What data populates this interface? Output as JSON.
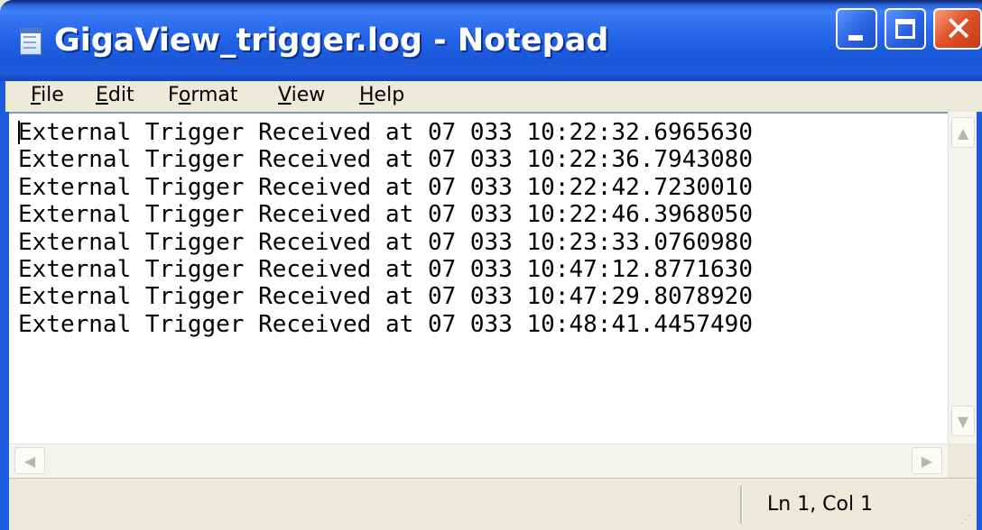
{
  "window": {
    "title": "GigaView_trigger.log - Notepad",
    "icon": "notepad-icon",
    "controls": {
      "minimize": "minimize-icon",
      "maximize": "maximize-icon",
      "close_glyph": "✕"
    }
  },
  "menu": {
    "items": [
      {
        "accel": "F",
        "rest": "ile"
      },
      {
        "accel": "E",
        "rest": "dit"
      },
      {
        "pre": "F",
        "accel": "o",
        "rest": "rmat"
      },
      {
        "accel": "V",
        "rest": "iew"
      },
      {
        "accel": "H",
        "rest": "elp"
      }
    ]
  },
  "editor": {
    "lines": [
      "External Trigger Received at 07 033 10:22:32.6965630",
      "External Trigger Received at 07 033 10:22:36.7943080",
      "External Trigger Received at 07 033 10:22:42.7230010",
      "External Trigger Received at 07 033 10:22:46.3968050",
      "External Trigger Received at 07 033 10:23:33.0760980",
      "External Trigger Received at 07 033 10:47:12.8771630",
      "External Trigger Received at 07 033 10:47:29.8078920",
      "External Trigger Received at 07 033 10:48:41.4457490"
    ]
  },
  "scrollbars": {
    "up": "▲",
    "down": "▼",
    "left": "◀",
    "right": "▶"
  },
  "status": {
    "position": "Ln 1, Col 1"
  },
  "colors": {
    "titlebar": "#1d5cde",
    "close_button": "#e0532b",
    "chrome": "#ece9d8"
  }
}
